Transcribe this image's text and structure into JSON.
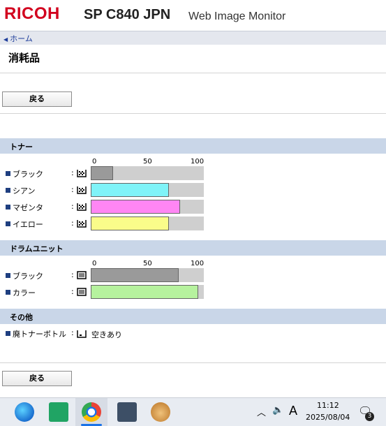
{
  "header": {
    "logo": "RICOH",
    "model": "SP C840 JPN",
    "app_name": "Web Image Monitor"
  },
  "nav": {
    "home": "ホーム"
  },
  "page_title": "消耗品",
  "back_button": "戻る",
  "scale_labels": [
    "0",
    "50",
    "100"
  ],
  "toner": {
    "title": "トナー",
    "items": [
      {
        "label": "ブラック",
        "icon": "toner-level-icon",
        "percent": 20,
        "color": "#9a9a9a"
      },
      {
        "label": "シアン",
        "icon": "toner-level-icon",
        "percent": 70,
        "color": "#7ff3f8"
      },
      {
        "label": "マゼンタ",
        "icon": "toner-level-icon",
        "percent": 80,
        "color": "#ff86f4"
      },
      {
        "label": "イエロー",
        "icon": "toner-level-icon",
        "percent": 70,
        "color": "#fafc8a"
      }
    ]
  },
  "drum": {
    "title": "ドラムユニット",
    "items": [
      {
        "label": "ブラック",
        "icon": "drum-level-icon",
        "percent": 79,
        "color": "#9a9a9a"
      },
      {
        "label": "カラー",
        "icon": "drum-level-icon",
        "percent": 96,
        "color": "#b6f29e"
      }
    ]
  },
  "other": {
    "title": "その他",
    "items": [
      {
        "label": "廃トナーボトル",
        "icon": "waste-bottle-icon",
        "status": "空きあり"
      }
    ]
  },
  "taskbar": {
    "time": "11:12",
    "date": "2025/08/04",
    "ime": "A",
    "notifications": "3"
  }
}
